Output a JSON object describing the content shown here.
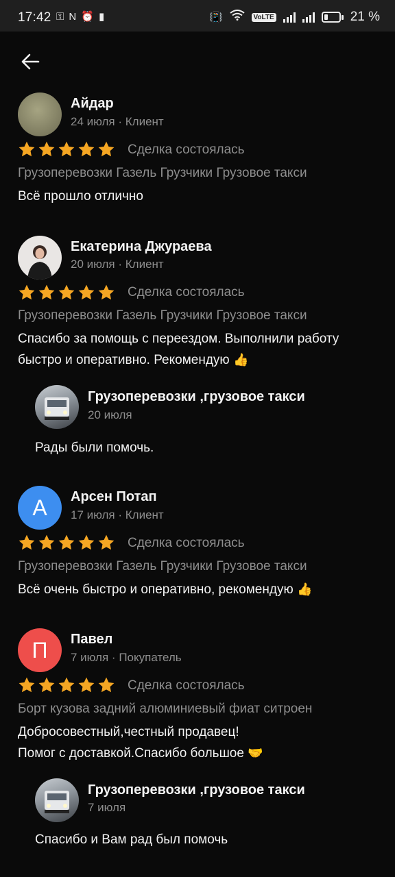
{
  "status_bar": {
    "time": "17:42",
    "battery_percent": "21 %",
    "icons": [
      "key-icon",
      "nfc-icon",
      "alarm-icon",
      "battery-alert-icon",
      "vibrate-icon",
      "wifi-icon",
      "volte-icon",
      "signal-icon",
      "signal-icon",
      "battery-icon"
    ],
    "volte": "VoLTE"
  },
  "header": {
    "back_icon": "arrow-left-icon"
  },
  "colors": {
    "star": "#f5a623",
    "avatar_blue": "#3d8ef0",
    "avatar_red": "#ee4e4b"
  },
  "reviews": [
    {
      "name": "Айдар",
      "date": "24 июля",
      "role": "Клиент",
      "rating": 5,
      "status": "Сделка состоялась",
      "category": "Грузоперевозки Газель Грузчики Грузовое такси",
      "text": "Всё прошло отлично"
    },
    {
      "name": "Екатерина Джураева",
      "date": "20 июля",
      "role": "Клиент",
      "rating": 5,
      "status": "Сделка состоялась",
      "category": "Грузоперевозки Газель Грузчики Грузовое такси",
      "text_lines": [
        "Спасибо за помощь с переездом. Выполнили работу",
        "быстро и оперативно. Рекомендую"
      ],
      "text_emoji": "👍",
      "reply": {
        "name": "Грузоперевозки ,грузовое такси",
        "date": "20 июля",
        "text": "Рады были помочь."
      }
    },
    {
      "name": "Арсен Потап",
      "avatar_letter": "А",
      "date": "17 июля",
      "role": "Клиент",
      "rating": 5,
      "status": "Сделка состоялась",
      "category": "Грузоперевозки Газель Грузчики Грузовое такси",
      "text": "Всё очень быстро и оперативно, рекомендую",
      "text_emoji": "👍"
    },
    {
      "name": "Павел",
      "avatar_letter": "П",
      "date": "7 июля",
      "role": "Покупатель",
      "rating": 5,
      "status": "Сделка состоялась",
      "category": "Борт кузова задний алюминиевый фиат ситроен",
      "text_lines": [
        "Добросовестный,честный продавец!",
        "Помог с доставкой.Спасибо большое"
      ],
      "text_emoji": "🤝",
      "reply": {
        "name": "Грузоперевозки ,грузовое такси",
        "date": "7 июля",
        "text": "Спасибо и Вам рад был помочь"
      }
    }
  ]
}
